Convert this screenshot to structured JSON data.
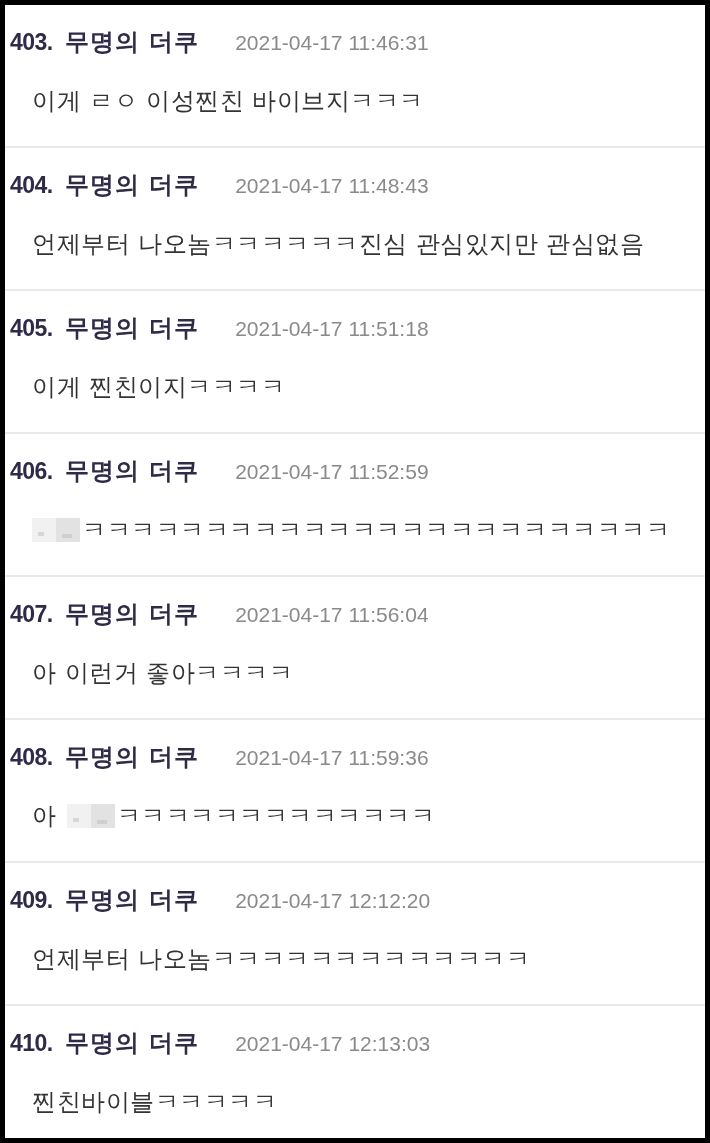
{
  "comments": [
    {
      "number": "403.",
      "author": "무명의 더쿠",
      "time": "2021-04-17 11:46:31",
      "body": [
        {
          "kind": "text",
          "text": "이게 ㄹㅇ 이성찐친 바이브지ㅋㅋㅋ"
        }
      ]
    },
    {
      "number": "404.",
      "author": "무명의 더쿠",
      "time": "2021-04-17 11:48:43",
      "body": [
        {
          "kind": "text",
          "text": "언제부터 나오놈ㅋㅋㅋㅋㅋㅋ진심 관심있지만 관심없음"
        }
      ]
    },
    {
      "number": "405.",
      "author": "무명의 더쿠",
      "time": "2021-04-17 11:51:18",
      "body": [
        {
          "kind": "text",
          "text": "이게 찐친이지ㅋㅋㅋㅋ"
        }
      ]
    },
    {
      "number": "406.",
      "author": "무명의 더쿠",
      "time": "2021-04-17 11:52:59",
      "body": [
        {
          "kind": "blur"
        },
        {
          "kind": "text",
          "text": "ㅋㅋㅋㅋㅋㅋㅋㅋㅋㅋㅋㅋㅋㅋㅋㅋㅋㅋㅋㅋㅋㅋㅋㅋ"
        }
      ]
    },
    {
      "number": "407.",
      "author": "무명의 더쿠",
      "time": "2021-04-17 11:56:04",
      "body": [
        {
          "kind": "text",
          "text": "아 이런거 좋아ㅋㅋㅋㅋ"
        }
      ]
    },
    {
      "number": "408.",
      "author": "무명의 더쿠",
      "time": "2021-04-17 11:59:36",
      "body": [
        {
          "kind": "text",
          "text": "아"
        },
        {
          "kind": "blur"
        },
        {
          "kind": "text",
          "text": "ㅋㅋㅋㅋㅋㅋㅋㅋㅋㅋㅋㅋㅋ"
        }
      ]
    },
    {
      "number": "409.",
      "author": "무명의 더쿠",
      "time": "2021-04-17 12:12:20",
      "body": [
        {
          "kind": "text",
          "text": "언제부터 나오놈ㅋㅋㅋㅋㅋㅋㅋㅋㅋㅋㅋㅋㅋ"
        }
      ]
    },
    {
      "number": "410.",
      "author": "무명의 더쿠",
      "time": "2021-04-17 12:13:03",
      "body": [
        {
          "kind": "text",
          "text": "찐친바이블ㅋㅋㅋㅋㅋ"
        }
      ]
    }
  ]
}
